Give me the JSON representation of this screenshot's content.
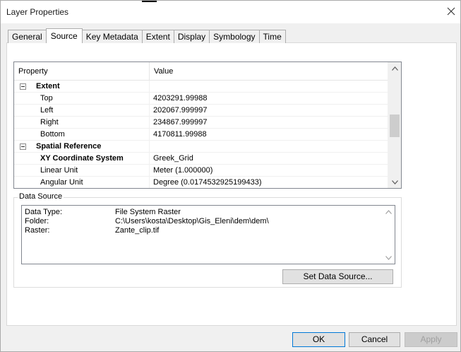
{
  "window": {
    "title": "Layer Properties"
  },
  "tabs": [
    {
      "label": "General"
    },
    {
      "label": "Source"
    },
    {
      "label": "Key Metadata"
    },
    {
      "label": "Extent"
    },
    {
      "label": "Display"
    },
    {
      "label": "Symbology"
    },
    {
      "label": "Time"
    }
  ],
  "grid": {
    "col_property": "Property",
    "col_value": "Value",
    "rows": [
      {
        "property": "Extent",
        "value": ""
      },
      {
        "property": "Top",
        "value": "4203291.99988"
      },
      {
        "property": "Left",
        "value": "202067.999997"
      },
      {
        "property": "Right",
        "value": "234867.999997"
      },
      {
        "property": "Bottom",
        "value": "4170811.99988"
      },
      {
        "property": "Spatial Reference",
        "value": ""
      },
      {
        "property": "XY Coordinate System",
        "value": "Greek_Grid"
      },
      {
        "property": "Linear Unit",
        "value": "Meter (1.000000)"
      },
      {
        "property": "Angular Unit",
        "value": "Degree (0.0174532925199433)"
      }
    ]
  },
  "data_source": {
    "label": "Data Source",
    "lines": [
      {
        "key": "Data Type:",
        "value": "File System Raster"
      },
      {
        "key": "Folder:",
        "value": "C:\\Users\\kosta\\Desktop\\Gis_Eleni\\dem\\dem\\"
      },
      {
        "key": "Raster:",
        "value": "Zante_clip.tif"
      }
    ],
    "set_button": "Set Data Source..."
  },
  "buttons": {
    "ok": "OK",
    "cancel": "Cancel",
    "apply": "Apply"
  }
}
